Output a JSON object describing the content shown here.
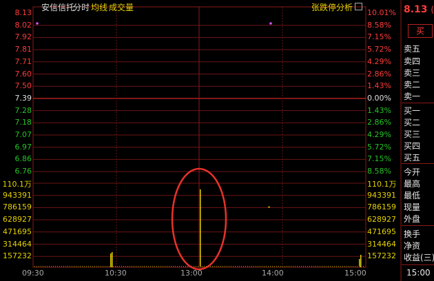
{
  "header": {
    "stock_name": "安信信托",
    "tab_intraday": "分时",
    "avg_line": "均线",
    "volume": "成交量",
    "limit_analysis": "张跌停分析",
    "current_price": "8.13",
    "current_price_suffix": "("
  },
  "price_axis": {
    "left": [
      "8.13",
      "8.02",
      "7.92",
      "7.81",
      "7.71",
      "7.60",
      "7.50",
      "7.39",
      "7.28",
      "7.18",
      "7.07",
      "6.97",
      "6.86",
      "6.76"
    ],
    "right": [
      "10.01%",
      "8.58%",
      "7.15%",
      "5.72%",
      "4.29%",
      "2.86%",
      "1.43%",
      "0.00%",
      "1.43%",
      "2.86%",
      "4.29%",
      "5.72%",
      "7.15%",
      "8.58%"
    ]
  },
  "volume_axis": {
    "left": [
      "110.1万",
      "943391",
      "786159",
      "628927",
      "471695",
      "314464",
      "157232"
    ],
    "right": [
      "110.1万",
      "943391",
      "786159",
      "628927",
      "471695",
      "314464",
      "157232"
    ]
  },
  "time_axis": [
    "09:30",
    "10:30",
    "13:00",
    "14:00",
    "15:00"
  ],
  "side_panel": {
    "buy_button": "买",
    "ask": [
      "卖五",
      "卖四",
      "卖三",
      "卖二",
      "卖一"
    ],
    "bid": [
      "买一",
      "买二",
      "买三",
      "买四",
      "买五"
    ],
    "quote": [
      "今开",
      "最高",
      "最低",
      "现量",
      "外盘"
    ],
    "stats": [
      "换手",
      "净资",
      "收益(三)"
    ],
    "time": "15:00"
  },
  "colors": {
    "up": "#ff3c3c",
    "down": "#27c427",
    "volume": "#e6d200",
    "grid": "#8a1a1a",
    "annotation": "#e8332a"
  }
}
